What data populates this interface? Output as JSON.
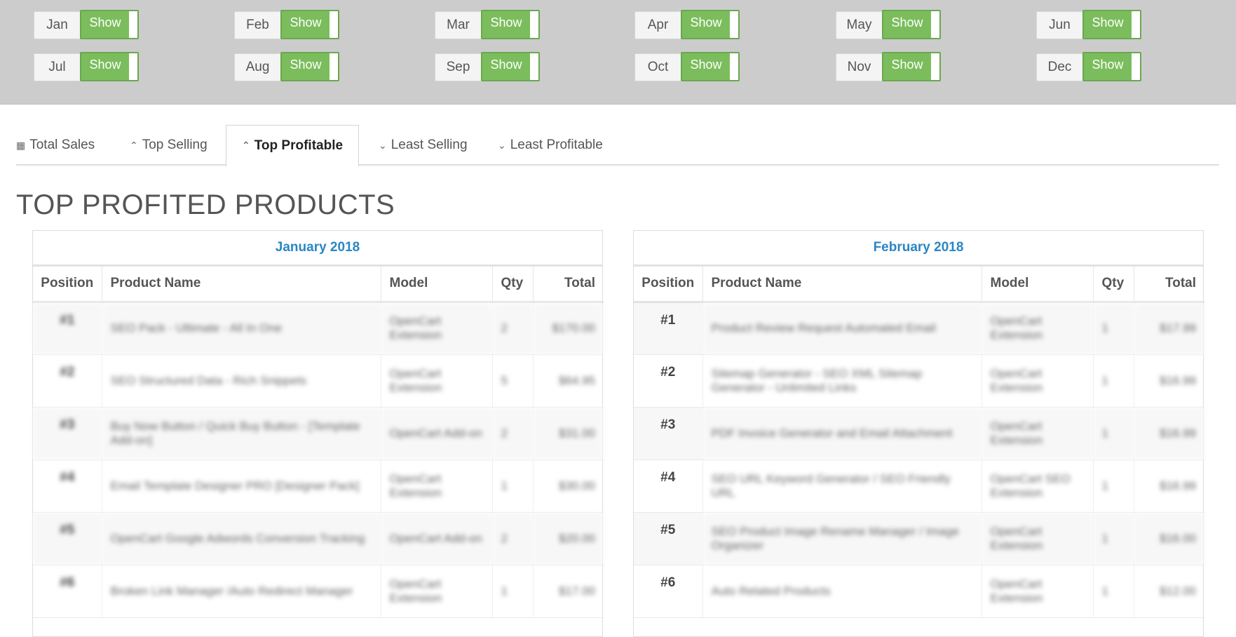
{
  "months": [
    {
      "label": "Jan",
      "toggle": "Show"
    },
    {
      "label": "Feb",
      "toggle": "Show"
    },
    {
      "label": "Mar",
      "toggle": "Show"
    },
    {
      "label": "Apr",
      "toggle": "Show"
    },
    {
      "label": "May",
      "toggle": "Show"
    },
    {
      "label": "Jun",
      "toggle": "Show"
    },
    {
      "label": "Jul",
      "toggle": "Show"
    },
    {
      "label": "Aug",
      "toggle": "Show"
    },
    {
      "label": "Sep",
      "toggle": "Show"
    },
    {
      "label": "Oct",
      "toggle": "Show"
    },
    {
      "label": "Nov",
      "toggle": "Show"
    },
    {
      "label": "Dec",
      "toggle": "Show"
    }
  ],
  "tabs": [
    {
      "label": "Total Sales",
      "icon": "table-icon",
      "glyph": "▦"
    },
    {
      "label": "Top Selling",
      "icon": "double-chevron-up-icon",
      "glyph": "⌃"
    },
    {
      "label": "Top Profitable",
      "icon": "double-chevron-up-icon",
      "glyph": "⌃"
    },
    {
      "label": "Least Selling",
      "icon": "double-chevron-down-icon",
      "glyph": "⌄"
    },
    {
      "label": "Least Profitable",
      "icon": "double-chevron-down-icon",
      "glyph": "⌄"
    }
  ],
  "active_tab": "Top Profitable",
  "page_title": "TOP PROFITED PRODUCTS",
  "colors": {
    "accent_green": "#7bbd5c",
    "link_blue": "#2a86c4",
    "bar_gray": "#cccccc"
  },
  "columns": {
    "position": "Position",
    "product": "Product Name",
    "model": "Model",
    "qty": "Qty",
    "total": "Total"
  },
  "tables": [
    {
      "title": "January 2018",
      "rows": [
        {
          "pos": "#1",
          "product": "SEO Pack - Ultimate - All In One",
          "model": "OpenCart Extension",
          "qty": "2",
          "total": "$170.00"
        },
        {
          "pos": "#2",
          "product": "SEO Structured Data - Rich Snippets",
          "model": "OpenCart Extension",
          "qty": "5",
          "total": "$64.95"
        },
        {
          "pos": "#3",
          "product": "Buy Now Button / Quick Buy Button - [Template Add-on]",
          "model": "OpenCart Add-on",
          "qty": "2",
          "total": "$31.00"
        },
        {
          "pos": "#4",
          "product": "Email Template Designer PRO [Designer Pack]",
          "model": "OpenCart Extension",
          "qty": "1",
          "total": "$30.00"
        },
        {
          "pos": "#5",
          "product": "OpenCart Google Adwords Conversion Tracking",
          "model": "OpenCart Add-on",
          "qty": "2",
          "total": "$20.00"
        },
        {
          "pos": "#6",
          "product": "Broken Link Manager /Auto Redirect Manager",
          "model": "OpenCart Extension",
          "qty": "1",
          "total": "$17.00"
        }
      ]
    },
    {
      "title": "February 2018",
      "rows": [
        {
          "pos": "#1",
          "product": "Product Review Request Automated Email",
          "model": "OpenCart Extension",
          "qty": "1",
          "total": "$17.99"
        },
        {
          "pos": "#2",
          "product": "Sitemap Generator - SEO XML Sitemap Generator - Unlimited Links",
          "model": "OpenCart Extension",
          "qty": "1",
          "total": "$16.99"
        },
        {
          "pos": "#3",
          "product": "PDF Invoice Generator and Email Attachment",
          "model": "OpenCart Extension",
          "qty": "1",
          "total": "$16.99"
        },
        {
          "pos": "#4",
          "product": "SEO URL Keyword Generator / SEO Friendly URL",
          "model": "OpenCart SEO Extension",
          "qty": "1",
          "total": "$16.99"
        },
        {
          "pos": "#5",
          "product": "SEO Product Image Rename Manager / Image Organizer",
          "model": "OpenCart Extension",
          "qty": "1",
          "total": "$16.00"
        },
        {
          "pos": "#6",
          "product": "Auto Related Products",
          "model": "OpenCart Extension",
          "qty": "1",
          "total": "$12.00"
        }
      ]
    }
  ]
}
